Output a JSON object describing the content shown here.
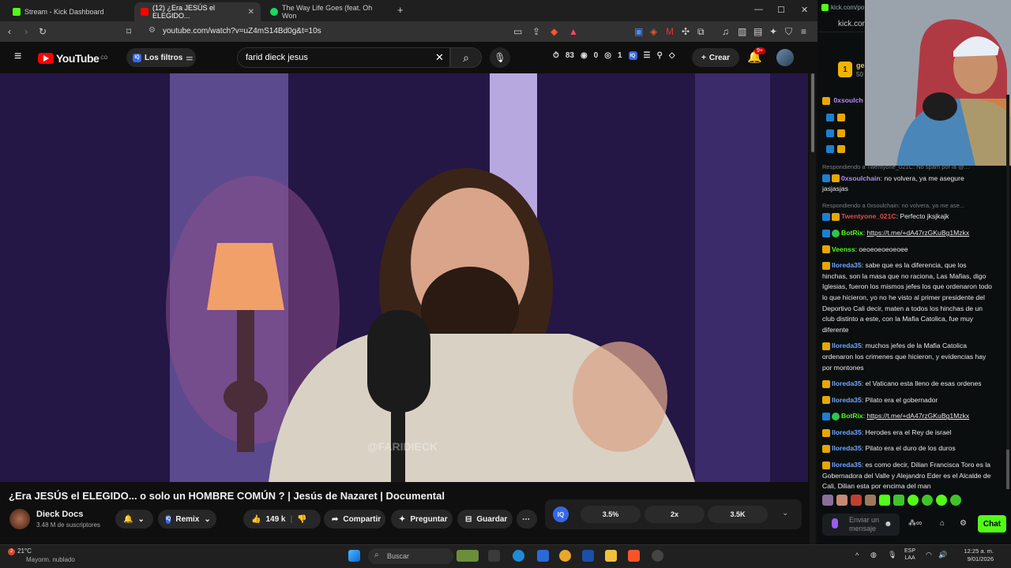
{
  "browser": {
    "tabs": [
      {
        "label": "Stream - Kick Dashboard",
        "color": "#53fc18",
        "active": false
      },
      {
        "label": "(12) ¿Era JESÚS el ELEGIDO...",
        "color": "#ff0000",
        "active": true
      },
      {
        "label": "The Way Life Goes (feat. Oh Won",
        "color": "#1ed760",
        "active": false
      }
    ],
    "new_tab": "+",
    "url": "youtube.com/watch?v=uZ4mS14Bd0g&t=10s"
  },
  "youtube": {
    "logo": "YouTube",
    "country": "CO",
    "filters_label": "Los filtros",
    "search_value": "farid dieck jesus",
    "stats": {
      "a": "83",
      "b": "0",
      "c": "1"
    },
    "create_label": "Crear",
    "notif_badge": "9+",
    "watermark": "@FARIDIECK",
    "video_title": "¿Era JESÚS el ELEGIDO... o solo un HOMBRE COMÚN ? | Jesús de Nazaret | Documental",
    "channel_name": "Dieck Docs",
    "subscribers": "3.48 M de suscriptores",
    "remix_label": "Remix",
    "likes": "149 k",
    "share_label": "Compartir",
    "ask_label": "Preguntar",
    "save_label": "Guardar",
    "iq_label": "IQ",
    "iq_values": [
      "3.5%",
      "2x",
      "3.5K"
    ]
  },
  "kick": {
    "url": "kick.com/po",
    "header": "kick.com",
    "pinned_name": "ge",
    "pinned_sub": "50",
    "pinned_rank": "1",
    "top_user": "0xsoulch",
    "messages": [
      {
        "reply": "Respondiendo a Twentyone_021C: No spam por la @...",
        "user": "0xsoulchain",
        "color": "#b58cf2",
        "badges": [
          "mod",
          "crown"
        ],
        "text": "no volvera, ya me asegure jasjasjas",
        "link": false
      },
      {
        "reply": "Respondiendo a 0xsoulchain: no volvera, ya me ase...",
        "user": "Twentyone_021C",
        "color": "#e64949",
        "badges": [
          "mod",
          "crown"
        ],
        "text": "Perfecto jksjkajk",
        "link": false
      },
      {
        "reply": "",
        "user": "BotRix",
        "color": "#53fc18",
        "badges": [
          "mod",
          "ver"
        ],
        "text": "https://t.me/+dA47rzGKuBg1Mzkx",
        "link": true
      },
      {
        "reply": "",
        "user": "Veenss",
        "color": "#53fc18",
        "badges": [
          "crown"
        ],
        "text": "oeoeoeoeoeoee",
        "link": false
      },
      {
        "reply": "",
        "user": "lloreda35",
        "color": "#6fa8ff",
        "badges": [
          "crown"
        ],
        "text": "sabe que es la diferencia, que los hinchas, son la masa que no raciona, Las Mafias, digo Iglesias, fueron los mismos jefes los que ordenaron todo lo que hicieron, yo no he visto al primer presidente del Deportivo Cali decir, maten a todos los hinchas de un club distinto a este, con la Mafia Catolica, fue muy diferente",
        "link": false
      },
      {
        "reply": "",
        "user": "lloreda35",
        "color": "#6fa8ff",
        "badges": [
          "crown"
        ],
        "text": "muchos jefes de la Mafia Catolica ordenaron los crimenes que hicieron, y evidencias hay por montones",
        "link": false
      },
      {
        "reply": "",
        "user": "lloreda35",
        "color": "#6fa8ff",
        "badges": [
          "crown"
        ],
        "text": "el Vaticano esta lleno de esas ordenes",
        "link": false
      },
      {
        "reply": "",
        "user": "lloreda35",
        "color": "#6fa8ff",
        "badges": [
          "crown"
        ],
        "text": "Pilato era el gobernador",
        "link": false
      },
      {
        "reply": "",
        "user": "BotRix",
        "color": "#53fc18",
        "badges": [
          "mod",
          "ver"
        ],
        "text": "https://t.me/+dA47rzGKuBg1Mzkx",
        "link": true
      },
      {
        "reply": "",
        "user": "lloreda35",
        "color": "#6fa8ff",
        "badges": [
          "crown"
        ],
        "text": "Herodes era el Rey de israel",
        "link": false
      },
      {
        "reply": "",
        "user": "lloreda35",
        "color": "#6fa8ff",
        "badges": [
          "crown"
        ],
        "text": "Pilato era el duro de los duros",
        "link": false
      },
      {
        "reply": "",
        "user": "lloreda35",
        "color": "#6fa8ff",
        "badges": [
          "crown"
        ],
        "text": "es como decir, Dilian Francisca Toro es la Gobernadora del Valle y Alejandro Eder es el Alcalde de Cali, Dilian esta por encima del man",
        "link": false
      }
    ],
    "input_placeholder": "Enviar un mensaje",
    "chat_button": "Chat"
  },
  "taskbar": {
    "temp": "21°C",
    "weather": "Mayorm. nublado",
    "weather_badge": "2",
    "search": "Buscar",
    "lang1": "ESP",
    "lang2": "LAA",
    "time": "12:25 a. m.",
    "date": "9/01/2026"
  }
}
